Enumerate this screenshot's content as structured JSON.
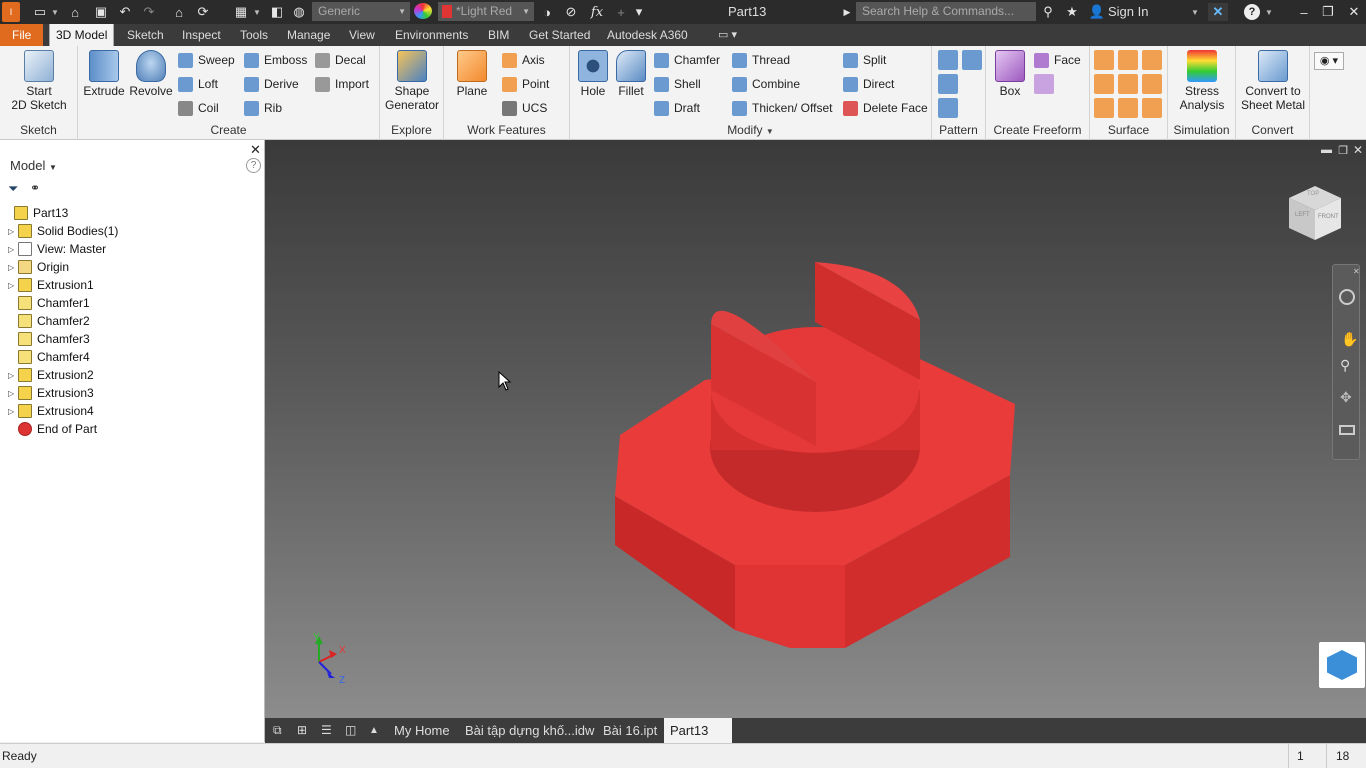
{
  "titlebar": {
    "material": "Generic",
    "appearance": "*Light Red",
    "fx": "fx",
    "document_title": "Part13",
    "search_placeholder": "Search Help & Commands...",
    "sign_in": "Sign In"
  },
  "tabs": [
    "File",
    "3D Model",
    "Sketch",
    "Inspect",
    "Tools",
    "Manage",
    "View",
    "Environments",
    "BIM",
    "Get Started",
    "Autodesk A360"
  ],
  "ribbon": {
    "sketch": {
      "start_line1": "Start",
      "start_line2": "2D Sketch",
      "group": "Sketch"
    },
    "create": {
      "extrude": "Extrude",
      "revolve": "Revolve",
      "sweep": "Sweep",
      "loft": "Loft",
      "coil": "Coil",
      "emboss": "Emboss",
      "derive": "Derive",
      "rib": "Rib",
      "decal": "Decal",
      "import": "Import",
      "group": "Create"
    },
    "explore": {
      "line1": "Shape",
      "line2": "Generator",
      "group": "Explore"
    },
    "work": {
      "plane": "Plane",
      "axis": "Axis",
      "point": "Point",
      "ucs": "UCS",
      "group": "Work Features"
    },
    "modify": {
      "hole": "Hole",
      "fillet": "Fillet",
      "chamfer": "Chamfer",
      "shell": "Shell",
      "draft": "Draft",
      "thread": "Thread",
      "combine": "Combine",
      "thicken": "Thicken/ Offset",
      "split": "Split",
      "direct": "Direct",
      "delete_face": "Delete Face",
      "group": "Modify"
    },
    "pattern": {
      "group": "Pattern"
    },
    "freeform": {
      "box": "Box",
      "face": "Face",
      "group": "Create Freeform"
    },
    "surface": {
      "group": "Surface"
    },
    "simulation": {
      "line1": "Stress",
      "line2": "Analysis",
      "group": "Simulation"
    },
    "convert": {
      "line1": "Convert to",
      "line2": "Sheet Metal",
      "group": "Convert"
    }
  },
  "panel": {
    "title": "Model",
    "tree": [
      {
        "label": "Part13",
        "expander": false,
        "indent": 0
      },
      {
        "label": "Solid Bodies(1)",
        "expander": true,
        "indent": 1
      },
      {
        "label": "View: Master",
        "expander": true,
        "indent": 1
      },
      {
        "label": "Origin",
        "expander": true,
        "indent": 1
      },
      {
        "label": "Extrusion1",
        "expander": true,
        "indent": 1
      },
      {
        "label": "Chamfer1",
        "expander": false,
        "indent": 1
      },
      {
        "label": "Chamfer2",
        "expander": false,
        "indent": 1
      },
      {
        "label": "Chamfer3",
        "expander": false,
        "indent": 1
      },
      {
        "label": "Chamfer4",
        "expander": false,
        "indent": 1
      },
      {
        "label": "Extrusion2",
        "expander": true,
        "indent": 1
      },
      {
        "label": "Extrusion3",
        "expander": true,
        "indent": 1
      },
      {
        "label": "Extrusion4",
        "expander": true,
        "indent": 1
      },
      {
        "label": "End of Part",
        "expander": false,
        "indent": 1
      }
    ]
  },
  "viewcube": {
    "front": "FRONT",
    "left": "LEFT",
    "top": "TOP"
  },
  "triad": {
    "x": "X",
    "y": "Y",
    "z": "Z"
  },
  "doctabs": {
    "home": "My Home",
    "tab1": "Bài tập dựng khố...idw",
    "tab2": "Bài 16.ipt",
    "tab3": "Part13"
  },
  "status": {
    "text": "Ready",
    "num1": "1",
    "num2": "18"
  },
  "colors": {
    "part": "#e03535",
    "file_tab": "#e06a1d"
  }
}
